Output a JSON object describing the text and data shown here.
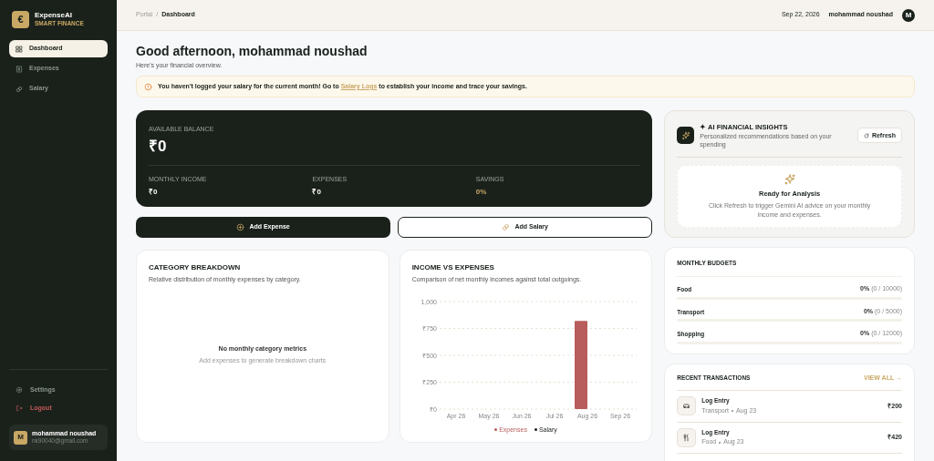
{
  "brand": {
    "name": "ExpenseAI",
    "tagline": "SMART FINANCE",
    "logo": "€"
  },
  "nav": [
    {
      "label": "Dashboard",
      "kind": "grid",
      "selected": true
    },
    {
      "label": "Expenses",
      "kind": "receipt",
      "selected": false
    },
    {
      "label": "Salary",
      "kind": "coins",
      "selected": false
    }
  ],
  "sidebar_footer": [
    {
      "label": "Settings",
      "kind": "settings"
    },
    {
      "label": "Logout",
      "kind": "logout"
    }
  ],
  "user": {
    "initial": "M",
    "name": "mohammad noushad",
    "email": "nk90040@gmail.com"
  },
  "breadcrumb": [
    "Portal",
    "/",
    "Dashboard"
  ],
  "header": {
    "date": "Sep 22, 2026",
    "user": "mohammad noushad",
    "initial": "M"
  },
  "greeting": {
    "title": "Good afternoon, mohammad noushad",
    "subtitle": "Here's your financial overview."
  },
  "alert": {
    "before": "You haven't logged your salary for the current month! Go to",
    "link": "Salary Logs",
    "after": "to establish your income and trace your savings."
  },
  "balance": {
    "label": "AVAILABLE BALANCE",
    "value": "₹0",
    "stats": [
      {
        "label": "MONTHLY INCOME",
        "value": "₹0",
        "kind": "plain"
      },
      {
        "label": "EXPENSES",
        "value": "₹0",
        "kind": "plain"
      },
      {
        "label": "SAVINGS",
        "value": "0%",
        "kind": "accent"
      }
    ]
  },
  "actions": [
    {
      "label": "Add Expense",
      "kind": "primary"
    },
    {
      "label": "Add Salary",
      "kind": "secondary"
    }
  ],
  "category": {
    "title": "CATEGORY BREAKDOWN",
    "subtitle": "Relative distribution of monthly expenses by category.",
    "empty_title": "No monthly category metrics",
    "empty_text": "Add expenses to generate breakdown charts"
  },
  "income_vs_expenses": {
    "title": "INCOME VS EXPENSES",
    "subtitle": "Comparison of net monthly incomes against total outgoings.",
    "chart_data": {
      "type": "bar",
      "categories": [
        "Apr 26",
        "May 26",
        "Jun 26",
        "Jul 26",
        "Aug 26",
        "Sep 26"
      ],
      "series": [
        {
          "name": "Expenses",
          "color": "#b85c5c",
          "values": [
            0,
            0,
            0,
            0,
            820,
            0
          ]
        },
        {
          "name": "Salary",
          "color": "#1a211b",
          "values": [
            0,
            0,
            0,
            0,
            0,
            0
          ]
        }
      ],
      "grid": true,
      "ylim": [
        0,
        1000
      ],
      "yticks": [
        {
          "value": 0,
          "label": "₹0"
        },
        {
          "value": 250,
          "label": "₹250"
        },
        {
          "value": 500,
          "label": "₹500"
        },
        {
          "value": 750,
          "label": "₹750"
        },
        {
          "value": 1000,
          "label": "1,000"
        }
      ]
    }
  },
  "insights": {
    "title": "✦ AI FINANCIAL INSIGHTS",
    "subtitle": "Personalized recommendations based on your spending",
    "refresh": "Refresh",
    "ready_title": "Ready for Analysis",
    "ready_text": "Click Refresh to trigger Gemini AI advice on your monthly income and expenses."
  },
  "budgets": {
    "title": "MONTHLY BUDGETS",
    "items": [
      {
        "name": "Food",
        "percent": "0%",
        "detail": "(0 / 10000)",
        "level": 0
      },
      {
        "name": "Transport",
        "percent": "0%",
        "detail": "(0 / 5000)",
        "level": 0
      },
      {
        "name": "Shopping",
        "percent": "0%",
        "detail": "(0 / 12000)",
        "level": 0
      }
    ]
  },
  "transactions": {
    "title": "RECENT TRANSACTIONS",
    "view_all": "VIEW ALL →",
    "items": [
      {
        "title": "Log Entry",
        "category": "Transport",
        "date": "Aug 23",
        "amount": "₹200",
        "kind": "car"
      },
      {
        "title": "Log Entry",
        "category": "Food",
        "date": "Aug 23",
        "amount": "₹420",
        "kind": "food"
      }
    ]
  }
}
